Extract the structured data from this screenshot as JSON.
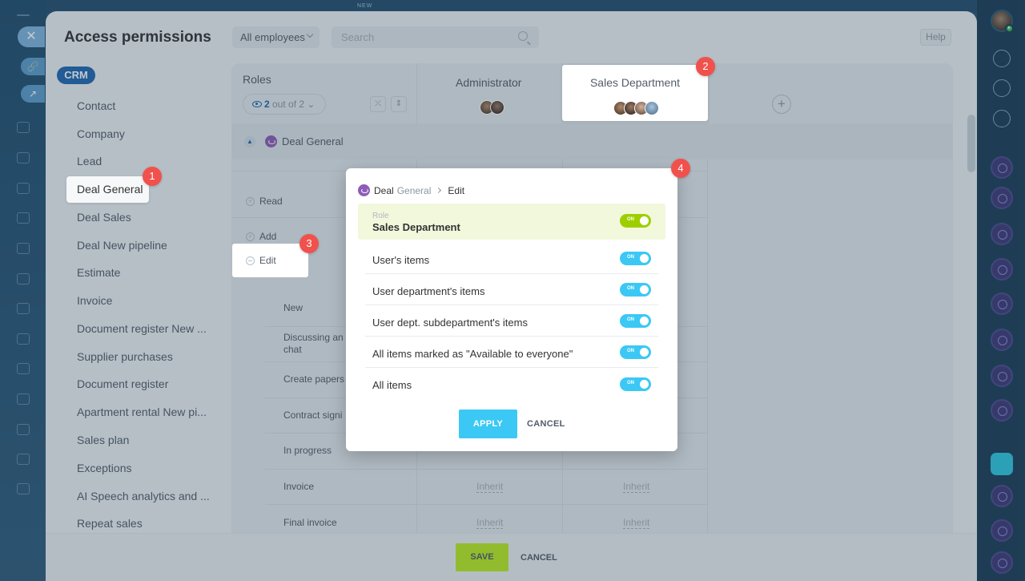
{
  "background": {
    "new_label": "NEW"
  },
  "header": {
    "title": "Access permissions",
    "employees_filter": "All employees",
    "search_placeholder": "Search",
    "help_label": "Help"
  },
  "sidebar": {
    "badge": "CRM",
    "items": [
      {
        "label": "Contact"
      },
      {
        "label": "Company"
      },
      {
        "label": "Lead"
      },
      {
        "label": "Deal General",
        "active": true
      },
      {
        "label": "Deal Sales"
      },
      {
        "label": "Deal New pipeline"
      },
      {
        "label": "Estimate"
      },
      {
        "label": "Invoice"
      },
      {
        "label": "Document register New ..."
      },
      {
        "label": "Supplier purchases"
      },
      {
        "label": "Document register"
      },
      {
        "label": "Apartment rental New pi..."
      },
      {
        "label": "Sales plan"
      },
      {
        "label": "Exceptions"
      },
      {
        "label": "AI Speech analytics and ..."
      },
      {
        "label": "Repeat sales"
      }
    ]
  },
  "table": {
    "roles_label": "Roles",
    "view_count": "2",
    "view_suffix": "out of 2",
    "columns": [
      {
        "label": "Administrator"
      },
      {
        "label": "Sales Department"
      }
    ],
    "section_title": "Deal General",
    "permissions": [
      "Read",
      "Add",
      "Edit"
    ],
    "stages": [
      "New",
      "Discussing an\nchat",
      "Create papers",
      "Contract signi",
      "In progress",
      "Invoice",
      "Final invoice"
    ],
    "inherit_label": "Inherit"
  },
  "popup": {
    "crumb_entity": "Deal",
    "crumb_sub": "General",
    "crumb_action": "Edit",
    "role_label": "Role",
    "role_value": "Sales Department",
    "toggle_on_label": "ON",
    "options": [
      {
        "label": "User's items",
        "on": true
      },
      {
        "label": "User department's items",
        "on": true
      },
      {
        "label": "User dept. subdepartment's items",
        "on": true
      },
      {
        "label": "All items marked as \"Available to everyone\"",
        "on": true
      },
      {
        "label": "All items",
        "on": true
      }
    ],
    "apply_label": "APPLY",
    "cancel_label": "CANCEL"
  },
  "footer": {
    "save_label": "SAVE",
    "cancel_label": "CANCEL"
  },
  "callouts": [
    "1",
    "2",
    "3",
    "4"
  ],
  "colors": {
    "accent_blue": "#2067b0",
    "toggle_blue": "#3bc8f5",
    "toggle_green": "#9dcf00",
    "save_green": "#bbed21",
    "badge_red": "#f0514c"
  }
}
